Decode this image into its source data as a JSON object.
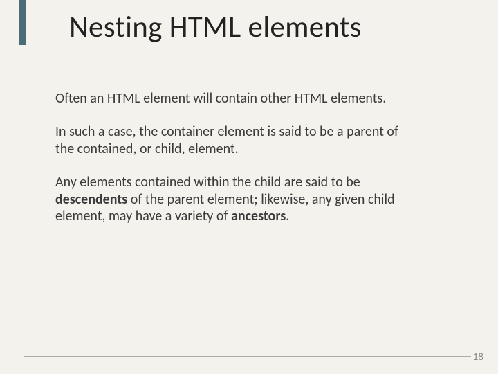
{
  "title": "Nesting HTML elements",
  "p1": "Often an HTML element will contain other HTML elements.",
  "p2": "In such a case, the container element is said to be a parent of the contained, or child, element.",
  "p3a": "Any elements contained within the child are said to be ",
  "p3b": "descendents",
  "p3c": " of the parent element; likewise, any given child element, may have a variety of ",
  "p3d": "ancestors",
  "p3e": ".",
  "page": "18"
}
